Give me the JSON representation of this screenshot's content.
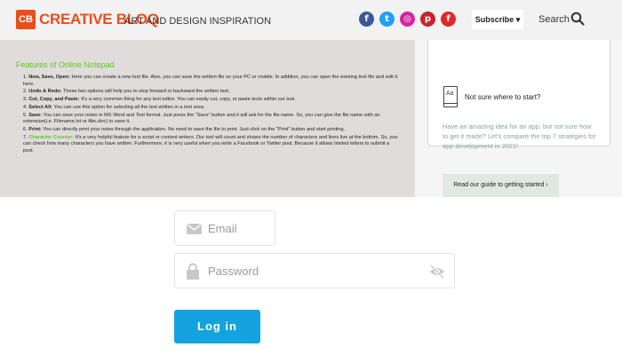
{
  "header": {
    "logo_mark": "CB",
    "logo_text": "CREATIVE BLOQ",
    "tagline": "ART AND DESIGN INSPIRATION",
    "social": [
      {
        "icon": "facebook-icon",
        "glyph": "f",
        "color": "#3b5998"
      },
      {
        "icon": "twitter-icon",
        "glyph": "t",
        "color": "#1da1f2"
      },
      {
        "icon": "instagram-icon",
        "glyph": "◎",
        "color": "#d6249f"
      },
      {
        "icon": "pinterest-icon",
        "glyph": "p",
        "color": "#c8232c"
      },
      {
        "icon": "flipboard-icon",
        "glyph": "f",
        "color": "#e12828"
      }
    ],
    "subscribe_label": "Subscribe ▾",
    "search_label": "Search"
  },
  "notepad": {
    "title": "Features of Online Notepad",
    "items": [
      {
        "num": "1.",
        "bold": "New, Save, Open:",
        "text": " Here you can create a new text file. Also, you can save the written file on your PC or mobile. In addition, you can open the existing text file and edit it here."
      },
      {
        "num": "2.",
        "bold": "Undo & Redo:",
        "text": " These two options will help you to step forward or backward the written text."
      },
      {
        "num": "3.",
        "bold": "Cut, Copy, and Paste:",
        "text": " It's a very common thing for any text editor. You can easily cut, copy, or paste texts within our tool."
      },
      {
        "num": "4.",
        "bold": "Select All:",
        "text": " You can use this option for selecting all the text written in a text area."
      },
      {
        "num": "5.",
        "bold": "Save:",
        "text": " You can save your notes in MS Word and Text format. Just press the \"Save\" button and it will ask for the file name. So, you can give the file name with an extension(i.e. Filename.txt or Abc.doc) to save it."
      },
      {
        "num": "6.",
        "bold": "Print:",
        "text": " You can directly print your notes through the application. No need to save the file to print. Just click on the \"Print\" button and start printing."
      },
      {
        "num": "7.",
        "bold": "Character Counter:",
        "text": " It's a very helpful feature for a script or content writers. Our tool will count and shows the number of characters and lines live at the bottom. So, you can check how many characters you have written. Furthermore, it is very useful when you write a Facebook or Twitter post. Because it allows limited letters to submit a post."
      }
    ]
  },
  "card": {
    "icon_text": "Aa",
    "title": "Not sure where to start?",
    "text": "Have an amazing idea for an app, but not sure how to get it made? Let's compare the top 7 strategies for app development in 2021!",
    "button_label": "Read our guide to getting started ›"
  },
  "login": {
    "email_placeholder": "Email",
    "password_placeholder": "Password",
    "login_label": "Log in",
    "button_color": "#14a3de"
  }
}
